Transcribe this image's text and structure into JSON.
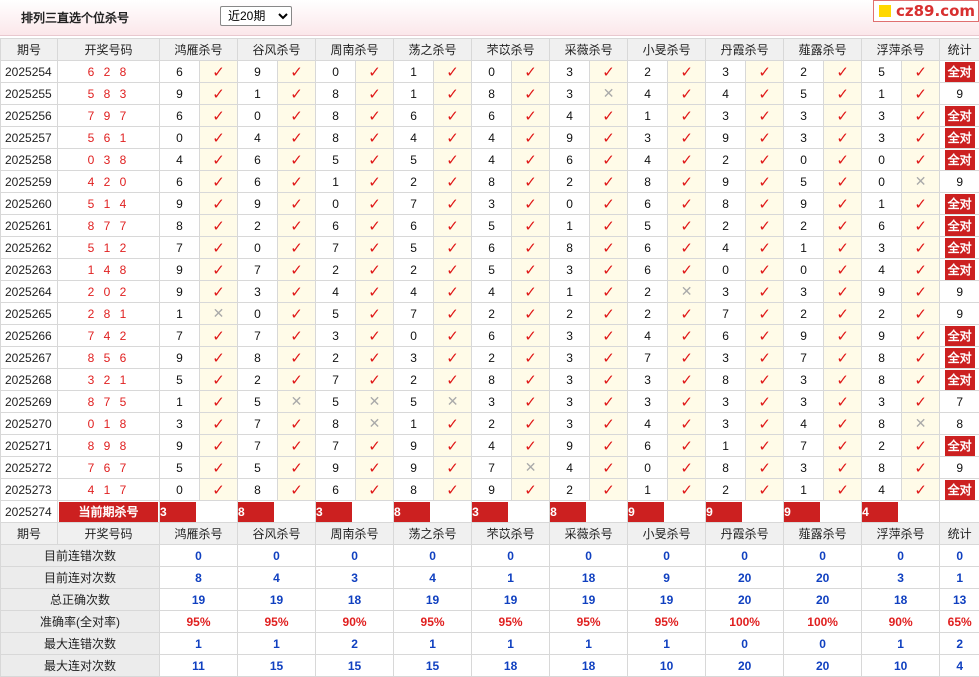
{
  "header": {
    "title": "排列三直选个位杀号",
    "range_selected": "近20期",
    "logo": "cz89.com"
  },
  "columns": {
    "issue": "期号",
    "draw": "开奖号码",
    "experts": [
      "鸿雁杀号",
      "谷风杀号",
      "周南杀号",
      "荡之杀号",
      "芣苡杀号",
      "采薇杀号",
      "小旻杀号",
      "丹霞杀号",
      "薤露杀号",
      "浮萍杀号"
    ],
    "stat": "统计"
  },
  "rows": [
    {
      "issue": "2025254",
      "draw": "6 2 8",
      "kills": [
        6,
        9,
        0,
        1,
        0,
        3,
        2,
        3,
        2,
        5
      ],
      "hits": [
        1,
        1,
        1,
        1,
        1,
        1,
        1,
        1,
        1,
        1
      ],
      "stat": "全对"
    },
    {
      "issue": "2025255",
      "draw": "5 8 3",
      "kills": [
        9,
        1,
        8,
        1,
        8,
        3,
        4,
        4,
        5,
        1
      ],
      "hits": [
        1,
        1,
        1,
        1,
        1,
        0,
        1,
        1,
        1,
        1
      ],
      "stat": "9"
    },
    {
      "issue": "2025256",
      "draw": "7 9 7",
      "kills": [
        6,
        0,
        8,
        6,
        6,
        4,
        1,
        3,
        3,
        3
      ],
      "hits": [
        1,
        1,
        1,
        1,
        1,
        1,
        1,
        1,
        1,
        1
      ],
      "stat": "全对"
    },
    {
      "issue": "2025257",
      "draw": "5 6 1",
      "kills": [
        0,
        4,
        8,
        4,
        4,
        9,
        3,
        9,
        3,
        3
      ],
      "hits": [
        1,
        1,
        1,
        1,
        1,
        1,
        1,
        1,
        1,
        1
      ],
      "stat": "全对"
    },
    {
      "issue": "2025258",
      "draw": "0 3 8",
      "kills": [
        4,
        6,
        5,
        5,
        4,
        6,
        4,
        2,
        0,
        0
      ],
      "hits": [
        1,
        1,
        1,
        1,
        1,
        1,
        1,
        1,
        1,
        1
      ],
      "stat": "全对"
    },
    {
      "issue": "2025259",
      "draw": "4 2 0",
      "kills": [
        6,
        6,
        1,
        2,
        8,
        2,
        8,
        9,
        5,
        0
      ],
      "hits": [
        1,
        1,
        1,
        1,
        1,
        1,
        1,
        1,
        1,
        0
      ],
      "stat": "9"
    },
    {
      "issue": "2025260",
      "draw": "5 1 4",
      "kills": [
        9,
        9,
        0,
        7,
        3,
        0,
        6,
        8,
        9,
        1
      ],
      "hits": [
        1,
        1,
        1,
        1,
        1,
        1,
        1,
        1,
        1,
        1
      ],
      "stat": "全对"
    },
    {
      "issue": "2025261",
      "draw": "8 7 7",
      "kills": [
        8,
        2,
        6,
        6,
        5,
        1,
        5,
        2,
        2,
        6
      ],
      "hits": [
        1,
        1,
        1,
        1,
        1,
        1,
        1,
        1,
        1,
        1
      ],
      "stat": "全对"
    },
    {
      "issue": "2025262",
      "draw": "5 1 2",
      "kills": [
        7,
        0,
        7,
        5,
        6,
        8,
        6,
        4,
        1,
        3
      ],
      "hits": [
        1,
        1,
        1,
        1,
        1,
        1,
        1,
        1,
        1,
        1
      ],
      "stat": "全对"
    },
    {
      "issue": "2025263",
      "draw": "1 4 8",
      "kills": [
        9,
        7,
        2,
        2,
        5,
        3,
        6,
        0,
        0,
        4
      ],
      "hits": [
        1,
        1,
        1,
        1,
        1,
        1,
        1,
        1,
        1,
        1
      ],
      "stat": "全对"
    },
    {
      "issue": "2025264",
      "draw": "2 0 2",
      "kills": [
        9,
        3,
        4,
        4,
        4,
        1,
        2,
        3,
        3,
        9
      ],
      "hits": [
        1,
        1,
        1,
        1,
        1,
        1,
        0,
        1,
        1,
        1
      ],
      "stat": "9"
    },
    {
      "issue": "2025265",
      "draw": "2 8 1",
      "kills": [
        1,
        0,
        5,
        7,
        2,
        2,
        2,
        7,
        2,
        2
      ],
      "hits": [
        0,
        1,
        1,
        1,
        1,
        1,
        1,
        1,
        1,
        1
      ],
      "stat": "9"
    },
    {
      "issue": "2025266",
      "draw": "7 4 2",
      "kills": [
        7,
        7,
        3,
        0,
        6,
        3,
        4,
        6,
        9,
        9
      ],
      "hits": [
        1,
        1,
        1,
        1,
        1,
        1,
        1,
        1,
        1,
        1
      ],
      "stat": "全对"
    },
    {
      "issue": "2025267",
      "draw": "8 5 6",
      "kills": [
        9,
        8,
        2,
        3,
        2,
        3,
        7,
        3,
        7,
        8
      ],
      "hits": [
        1,
        1,
        1,
        1,
        1,
        1,
        1,
        1,
        1,
        1
      ],
      "stat": "全对"
    },
    {
      "issue": "2025268",
      "draw": "3 2 1",
      "kills": [
        5,
        2,
        7,
        2,
        8,
        3,
        3,
        8,
        3,
        8
      ],
      "hits": [
        1,
        1,
        1,
        1,
        1,
        1,
        1,
        1,
        1,
        1
      ],
      "stat": "全对"
    },
    {
      "issue": "2025269",
      "draw": "8 7 5",
      "kills": [
        1,
        5,
        5,
        5,
        3,
        3,
        3,
        3,
        3,
        3
      ],
      "hits": [
        1,
        0,
        0,
        0,
        1,
        1,
        1,
        1,
        1,
        1
      ],
      "stat": "7"
    },
    {
      "issue": "2025270",
      "draw": "0 1 8",
      "kills": [
        3,
        7,
        8,
        1,
        2,
        3,
        4,
        3,
        4,
        8
      ],
      "hits": [
        1,
        1,
        0,
        1,
        1,
        1,
        1,
        1,
        1,
        0
      ],
      "stat": "8"
    },
    {
      "issue": "2025271",
      "draw": "8 9 8",
      "kills": [
        9,
        7,
        7,
        9,
        4,
        9,
        6,
        1,
        7,
        2
      ],
      "hits": [
        1,
        1,
        1,
        1,
        1,
        1,
        1,
        1,
        1,
        1
      ],
      "stat": "全对"
    },
    {
      "issue": "2025272",
      "draw": "7 6 7",
      "kills": [
        5,
        5,
        9,
        9,
        7,
        4,
        0,
        8,
        3,
        8
      ],
      "hits": [
        1,
        1,
        1,
        1,
        0,
        1,
        1,
        1,
        1,
        1
      ],
      "stat": "9"
    },
    {
      "issue": "2025273",
      "draw": "4 1 7",
      "kills": [
        0,
        8,
        6,
        8,
        9,
        2,
        1,
        2,
        1,
        4
      ],
      "hits": [
        1,
        1,
        1,
        1,
        1,
        1,
        1,
        1,
        1,
        1
      ],
      "stat": "全对"
    }
  ],
  "current": {
    "issue": "2025274",
    "label": "当前期杀号",
    "kills": [
      "3",
      "8",
      "3",
      "8",
      "3",
      "8",
      "9",
      "9",
      "9",
      "4"
    ]
  },
  "marks": {
    "hit": "✓",
    "miss": "✕"
  },
  "stats": [
    {
      "label": "目前连错次数",
      "values": [
        "0",
        "0",
        "0",
        "0",
        "0",
        "0",
        "0",
        "0",
        "0",
        "0"
      ],
      "total": "0"
    },
    {
      "label": "目前连对次数",
      "values": [
        "8",
        "4",
        "3",
        "4",
        "1",
        "18",
        "9",
        "20",
        "20",
        "3"
      ],
      "total": "1"
    },
    {
      "label": "总正确次数",
      "values": [
        "19",
        "19",
        "18",
        "19",
        "19",
        "19",
        "19",
        "20",
        "20",
        "18"
      ],
      "total": "13"
    },
    {
      "label": "准确率(全对率)",
      "values": [
        "95%",
        "95%",
        "90%",
        "95%",
        "95%",
        "95%",
        "95%",
        "100%",
        "100%",
        "90%"
      ],
      "total": "65%",
      "rate": true
    },
    {
      "label": "最大连错次数",
      "values": [
        "1",
        "1",
        "2",
        "1",
        "1",
        "1",
        "1",
        "0",
        "0",
        "1"
      ],
      "total": "2"
    },
    {
      "label": "最大连对次数",
      "values": [
        "11",
        "15",
        "15",
        "15",
        "18",
        "18",
        "10",
        "20",
        "20",
        "10"
      ],
      "total": "4"
    }
  ],
  "colors": {
    "accent_red": "#cc2020",
    "number_red": "#e02020",
    "stat_blue": "#1040c0"
  }
}
